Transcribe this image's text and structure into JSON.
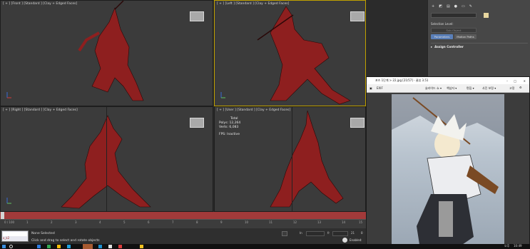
{
  "viewports": {
    "front": {
      "label": "[ + ] [Front ] [Standard ] [Clay + Edged Faces]"
    },
    "left": {
      "label": "[ + ] [Left ] [Standard ] [Clay + Edged Faces]"
    },
    "right": {
      "label": "[ + ] [Right ] [Standard ] [Clay + Edged Faces]"
    },
    "user": {
      "label": "[ + ] [User ] [Standard ] [Clay + Edged Faces]"
    }
  },
  "stats": {
    "total_label": "Total",
    "polys_label": "Polys:",
    "polys_value": "12,264",
    "verts_label": "Verts:",
    "verts_value": "6,083",
    "fps_label": "FPS:",
    "fps_value": "Inactive"
  },
  "right_panel": {
    "selection_level": "Selection Level:",
    "sub_object": "Sub-Object",
    "parameters": "Parameters",
    "motion_paths": "Motion Paths",
    "assign_controller": "Assign Controller"
  },
  "photo_viewer": {
    "title": "포즈 1단계 > 22.jpg [21/57] - 꿀뷰 3.51",
    "exif": "EXIF",
    "menu": [
      "슬라이드 쇼 ▾",
      "책넘자 ▾",
      "편집 ▾",
      "사진 보정 ▾",
      "고정"
    ]
  },
  "timeline": {
    "frame_counter": "0 / 100",
    "ticks": [
      "0",
      "1",
      "2",
      "3",
      "4",
      "5",
      "6",
      "7",
      "8",
      "9",
      "10",
      "11",
      "12",
      "13",
      "14",
      "15"
    ]
  },
  "status": {
    "selected": "None Selected",
    "hint": "Click and drag to select and rotate objects",
    "maxscript": "x_k2",
    "enabled": "Enabled:",
    "field_in": "In",
    "field_f": "fr",
    "field_b": "21",
    "field_c": "0"
  },
  "taskbar": {
    "lang": "오후",
    "time": "10:49"
  },
  "colors": {
    "model": "#8e1f1f",
    "wire": "#2a0808",
    "viewport_bg": "#3b3b3b",
    "active_border": "#c0a000",
    "timeline": "#a23a3a",
    "blue_btn": "#5a7fb8"
  }
}
